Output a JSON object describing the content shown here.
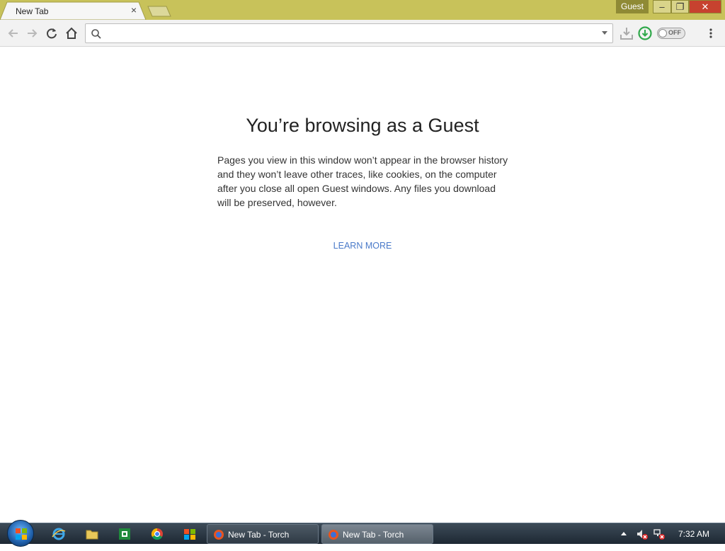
{
  "tab": {
    "title": "New Tab",
    "close_glyph": "×"
  },
  "profile": {
    "badge": "Guest"
  },
  "window_controls": {
    "minimize": "–",
    "maximize": "❐",
    "close": "✕"
  },
  "omnibox": {
    "value": "",
    "placeholder": ""
  },
  "toggle": {
    "label": "OFF"
  },
  "content": {
    "heading": "You’re browsing as a Guest",
    "body": "Pages you view in this window won’t appear in the browser history and they won’t leave other traces, like cookies, on the computer after you close all open Guest windows. Any files you download will be preserved, however.",
    "learn_more": "LEARN MORE"
  },
  "taskbar": {
    "tasks": [
      {
        "label": "New Tab - Torch"
      },
      {
        "label": "New Tab - Torch"
      }
    ],
    "clock": "7:32 AM"
  },
  "colors": {
    "titlebar": "#c8c25a",
    "guest_badge": "#8f8a35",
    "link": "#4a7ac9",
    "close_button": "#c7422f"
  },
  "icons": [
    "back-icon",
    "forward-icon",
    "reload-icon",
    "home-icon",
    "search-icon",
    "download-icon",
    "torch-download-icon",
    "menu-icon",
    "ie-icon",
    "folder-icon",
    "excel-icon",
    "chrome-icon",
    "windows-flag-icon",
    "volume-muted-icon",
    "network-icon"
  ]
}
